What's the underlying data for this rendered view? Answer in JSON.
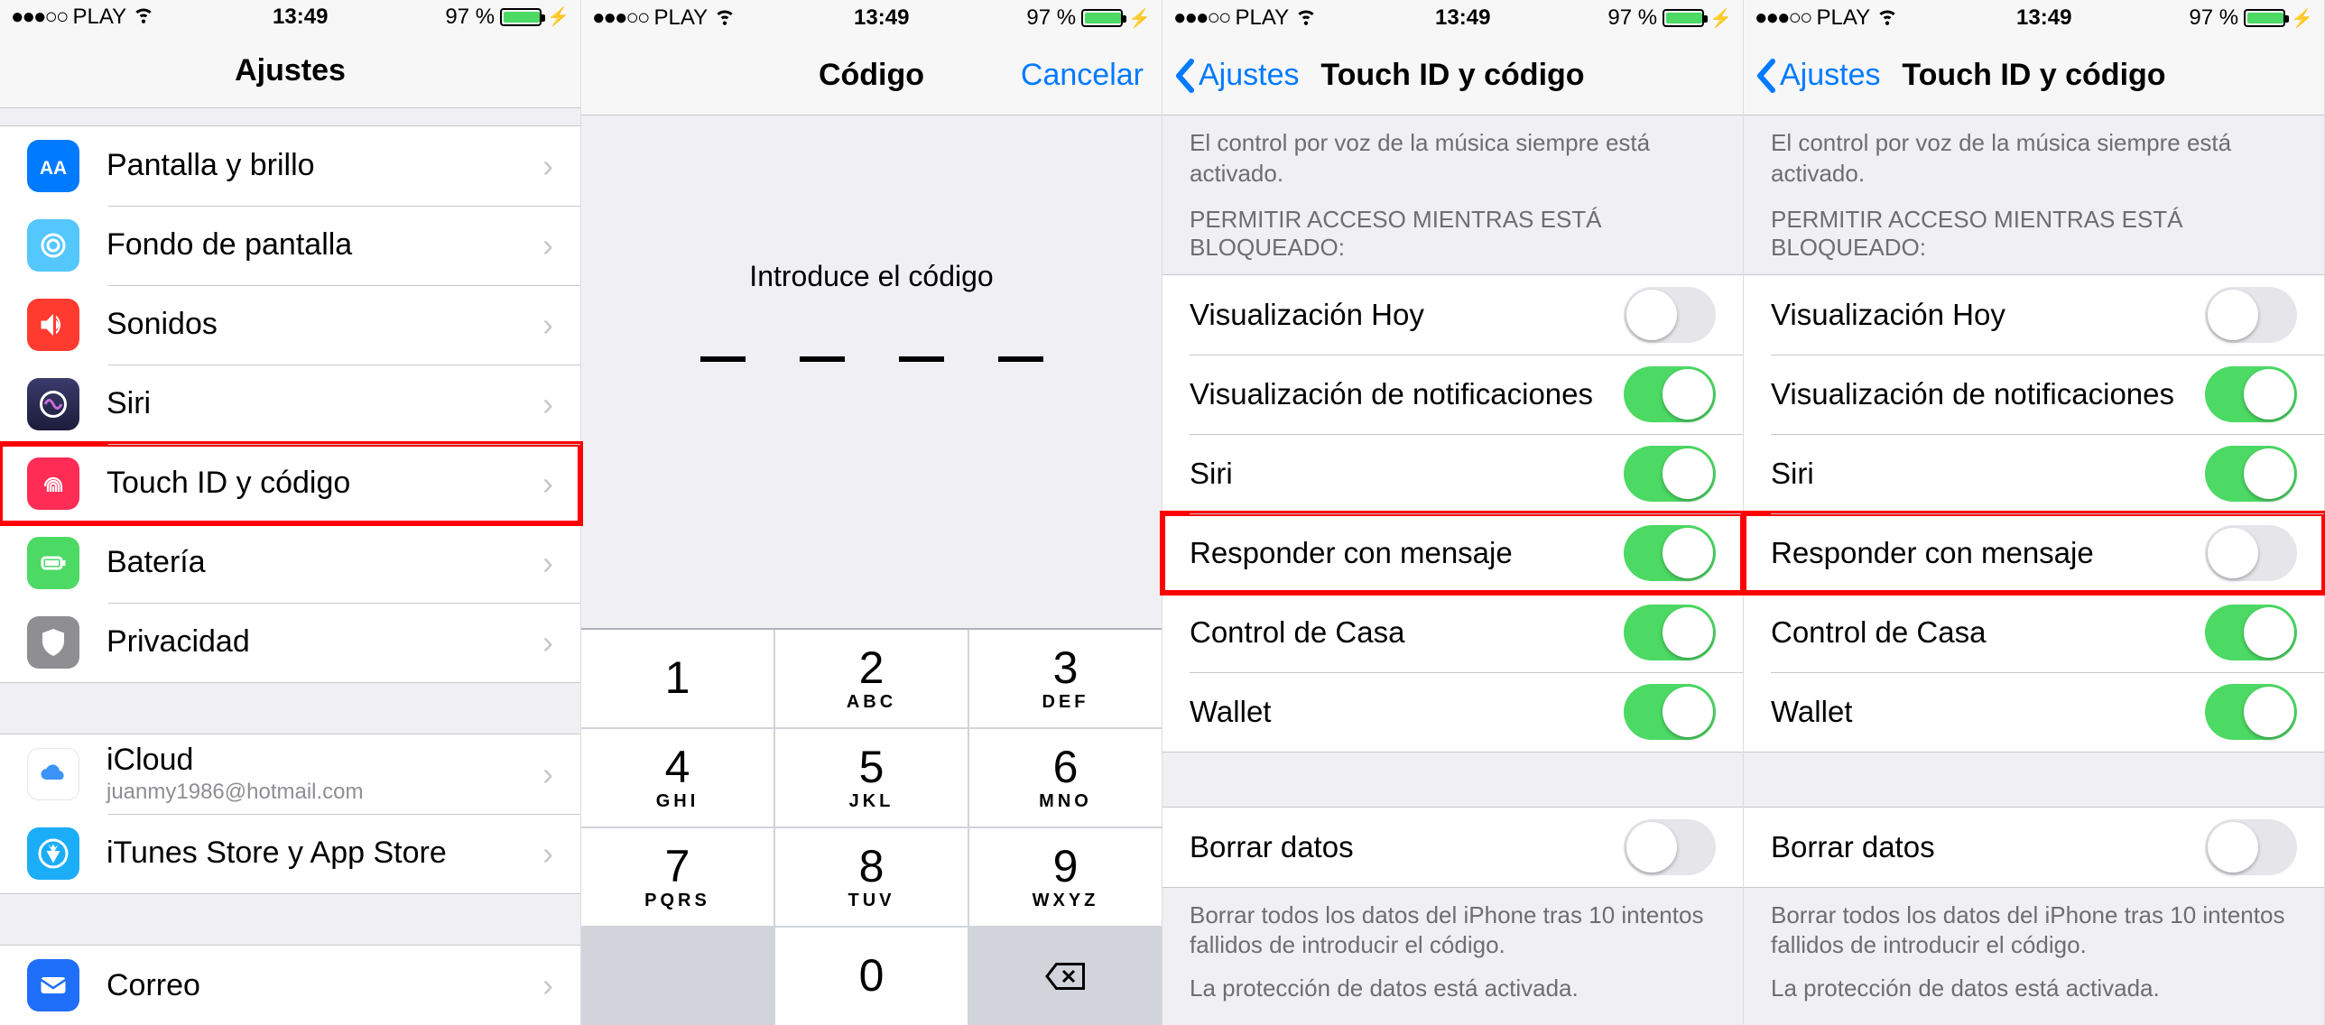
{
  "status": {
    "carrier": "PLAY",
    "time": "13:49",
    "battery_pct": "97 %",
    "signal_dots": "●●●○○"
  },
  "screen1": {
    "title": "Ajustes",
    "items": [
      {
        "label": "Pantalla y brillo",
        "icon": "display-icon",
        "color": "ic-blue"
      },
      {
        "label": "Fondo de pantalla",
        "icon": "wallpaper-icon",
        "color": "ic-cyan"
      },
      {
        "label": "Sonidos",
        "icon": "sounds-icon",
        "color": "ic-red"
      },
      {
        "label": "Siri",
        "icon": "siri-icon",
        "color": "ic-purple"
      },
      {
        "label": "Touch ID y código",
        "icon": "touchid-icon",
        "color": "ic-pink",
        "highlight": true
      },
      {
        "label": "Batería",
        "icon": "battery-icon",
        "color": "ic-green"
      },
      {
        "label": "Privacidad",
        "icon": "privacy-icon",
        "color": "ic-gray"
      }
    ],
    "group2": [
      {
        "label": "iCloud",
        "sub": "juanmy1986@hotmail.com",
        "icon": "icloud-icon",
        "color": "ic-white"
      },
      {
        "label": "iTunes Store y App Store",
        "icon": "appstore-icon",
        "color": "ic-appstore"
      }
    ],
    "group3": [
      {
        "label": "Correo",
        "icon": "mail-icon",
        "color": "ic-mail"
      }
    ]
  },
  "screen2": {
    "title": "Código",
    "cancel": "Cancelar",
    "prompt": "Introduce el código",
    "keys": [
      {
        "n": "1",
        "l": ""
      },
      {
        "n": "2",
        "l": "ABC"
      },
      {
        "n": "3",
        "l": "DEF"
      },
      {
        "n": "4",
        "l": "GHI"
      },
      {
        "n": "5",
        "l": "JKL"
      },
      {
        "n": "6",
        "l": "MNO"
      },
      {
        "n": "7",
        "l": "PQRS"
      },
      {
        "n": "8",
        "l": "TUV"
      },
      {
        "n": "9",
        "l": "WXYZ"
      },
      {
        "n": "",
        "l": "",
        "blank": true
      },
      {
        "n": "0",
        "l": ""
      },
      {
        "del": true
      }
    ]
  },
  "screen34_common": {
    "back": "Ajustes",
    "title": "Touch ID y código",
    "note_top": "El control por voz de la música siempre está activado.",
    "header": "PERMITIR ACCESO MIENTRAS ESTÁ BLOQUEADO:",
    "erase_label": "Borrar datos",
    "note_bottom": "Borrar todos los datos del iPhone tras 10 intentos fallidos de introducir el código.",
    "note_protection": "La protección de datos está activada."
  },
  "screen3": {
    "toggles": [
      {
        "label": "Visualización Hoy",
        "on": false
      },
      {
        "label": "Visualización de notificaciones",
        "on": true
      },
      {
        "label": "Siri",
        "on": true
      },
      {
        "label": "Responder con mensaje",
        "on": true,
        "highlight": true
      },
      {
        "label": "Control de Casa",
        "on": true
      },
      {
        "label": "Wallet",
        "on": true
      }
    ]
  },
  "screen4": {
    "toggles": [
      {
        "label": "Visualización Hoy",
        "on": false
      },
      {
        "label": "Visualización de notificaciones",
        "on": true
      },
      {
        "label": "Siri",
        "on": true
      },
      {
        "label": "Responder con mensaje",
        "on": false,
        "highlight": true
      },
      {
        "label": "Control de Casa",
        "on": true
      },
      {
        "label": "Wallet",
        "on": true
      }
    ]
  }
}
